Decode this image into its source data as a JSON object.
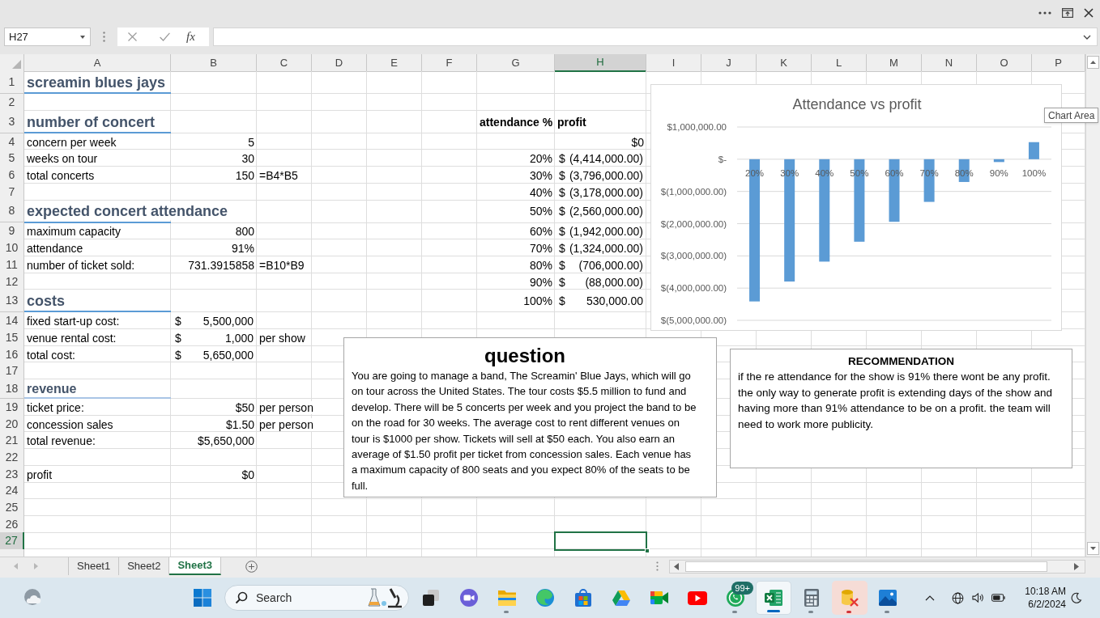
{
  "formula_bar": {
    "name_box": "H27",
    "function_button": "fx"
  },
  "columns": [
    {
      "label": "A",
      "selected": false
    },
    {
      "label": "B",
      "selected": false
    },
    {
      "label": "C",
      "selected": false
    },
    {
      "label": "D",
      "selected": false
    },
    {
      "label": "E",
      "selected": false
    },
    {
      "label": "F",
      "selected": false
    },
    {
      "label": "G",
      "selected": false
    },
    {
      "label": "H",
      "selected": true
    },
    {
      "label": "I",
      "selected": false
    },
    {
      "label": "J",
      "selected": false
    },
    {
      "label": "K",
      "selected": false
    },
    {
      "label": "L",
      "selected": false
    },
    {
      "label": "M",
      "selected": false
    },
    {
      "label": "N",
      "selected": false
    },
    {
      "label": "O",
      "selected": false
    },
    {
      "label": "P",
      "selected": false
    }
  ],
  "rows": [
    {
      "number": "1",
      "selected": false,
      "kind": "heading",
      "label": "screamin blues jays"
    },
    {
      "number": "2",
      "selected": false,
      "kind": "entry"
    },
    {
      "number": "3",
      "selected": false,
      "kind": "heading",
      "label": "number of concert"
    },
    {
      "number": "4",
      "selected": false,
      "kind": "entry",
      "label": "concern per week",
      "value": "5"
    },
    {
      "number": "5",
      "selected": false,
      "kind": "entry",
      "label": "weeks on tour",
      "value": "30"
    },
    {
      "number": "6",
      "selected": false,
      "kind": "entry",
      "label": "total concerts",
      "value": "150",
      "note": "=B4*B5"
    },
    {
      "number": "7",
      "selected": false,
      "kind": "entry"
    },
    {
      "number": "8",
      "selected": false,
      "kind": "heading",
      "label": "expected concert attendance"
    },
    {
      "number": "9",
      "selected": false,
      "kind": "entry",
      "label": "maximum capacity",
      "value": "800"
    },
    {
      "number": "10",
      "selected": false,
      "kind": "entry",
      "label": "attendance",
      "value": "91%"
    },
    {
      "number": "11",
      "selected": false,
      "kind": "entry",
      "label": "number of ticket sold:",
      "value": "731.3915858",
      "note": "=B10*B9"
    },
    {
      "number": "12",
      "selected": false,
      "kind": "entry"
    },
    {
      "number": "13",
      "selected": false,
      "kind": "heading",
      "label": "costs"
    },
    {
      "number": "14",
      "selected": false,
      "kind": "entry",
      "label": "fixed start-up cost:",
      "value": {
        "symbol": "$",
        "amount": "5,500,000"
      }
    },
    {
      "number": "15",
      "selected": false,
      "kind": "entry",
      "label": "venue rental cost:",
      "value": {
        "symbol": "$",
        "amount": "1,000"
      },
      "note": "per show"
    },
    {
      "number": "16",
      "selected": false,
      "kind": "entry",
      "label": "total cost:",
      "value": {
        "symbol": "$",
        "amount": "5,650,000"
      }
    },
    {
      "number": "17",
      "selected": false,
      "kind": "entry"
    },
    {
      "number": "18",
      "selected": false,
      "kind": "subheading",
      "label": "revenue"
    },
    {
      "number": "19",
      "selected": false,
      "kind": "entry",
      "label": "ticket price:",
      "value": "$50",
      "note": "per person"
    },
    {
      "number": "20",
      "selected": false,
      "kind": "entry",
      "label": "concession sales",
      "value": "$1.50",
      "note": "per person"
    },
    {
      "number": "21",
      "selected": false,
      "kind": "entry",
      "label": "total revenue:",
      "value": "$5,650,000"
    },
    {
      "number": "22",
      "selected": false,
      "kind": "entry"
    },
    {
      "number": "23",
      "selected": false,
      "kind": "entry",
      "label": "profit",
      "value": "$0"
    },
    {
      "number": "24",
      "selected": false,
      "kind": "entry"
    },
    {
      "number": "25",
      "selected": false,
      "kind": "entry"
    },
    {
      "number": "26",
      "selected": false,
      "kind": "entry"
    },
    {
      "number": "27",
      "selected": true,
      "kind": "entry"
    }
  ],
  "profit_table": {
    "header": {
      "attendance": "attendance %",
      "profit": "profit"
    },
    "rows": [
      {
        "profit": "$0"
      },
      {
        "attendance": "20%",
        "profit": {
          "symbol": "$",
          "amount": "(4,414,000.00)"
        }
      },
      {
        "attendance": "30%",
        "profit": {
          "symbol": "$",
          "amount": "(3,796,000.00)"
        }
      },
      {
        "attendance": "40%",
        "profit": {
          "symbol": "$",
          "amount": "(3,178,000.00)"
        }
      },
      {
        "attendance": "50%",
        "profit": {
          "symbol": "$",
          "amount": "(2,560,000.00)"
        }
      },
      {
        "attendance": "60%",
        "profit": {
          "symbol": "$",
          "amount": "(1,942,000.00)"
        }
      },
      {
        "attendance": "70%",
        "profit": {
          "symbol": "$",
          "amount": "(1,324,000.00)"
        }
      },
      {
        "attendance": "80%",
        "profit": {
          "symbol": "$",
          "amount": "(706,000.00)"
        }
      },
      {
        "attendance": "90%",
        "profit": {
          "symbol": "$",
          "amount": "(88,000.00)"
        }
      },
      {
        "attendance": "100%",
        "profit": {
          "symbol": "$",
          "amount": "530,000.00"
        }
      }
    ]
  },
  "chart": {
    "tooltip": "Chart Area",
    "chart_data": {
      "type": "bar",
      "title": "Attendance vs profit",
      "grid": true,
      "categories": [
        "20%",
        "30%",
        "40%",
        "50%",
        "60%",
        "70%",
        "80%",
        "90%",
        "100%"
      ],
      "series": [
        {
          "color": "#5b9bd5",
          "values": [
            -4414000,
            -3796000,
            -3178000,
            -2560000,
            -1942000,
            -1324000,
            -706000,
            -88000,
            530000
          ]
        }
      ],
      "ylim": [
        -5000000,
        1000000
      ],
      "yticks": [
        {
          "value": 1000000,
          "label": "$1,000,000.00"
        },
        {
          "value": 0,
          "label": "$-"
        },
        {
          "value": -1000000,
          "label": "$(1,000,000.00)"
        },
        {
          "value": -2000000,
          "label": "$(2,000,000.00)"
        },
        {
          "value": -3000000,
          "label": "$(3,000,000.00)"
        },
        {
          "value": -4000000,
          "label": "$(4,000,000.00)"
        },
        {
          "value": -5000000,
          "label": "$(5,000,000.00)"
        }
      ]
    }
  },
  "question_box": {
    "title": "question",
    "body": "You are going to manage a band, The Screamin' Blue Jays, which will go on tour across the United States. The tour costs $5.5 million to fund and develop. There will be 5 concerts per week and you project the band to be on the road for 30 weeks. The average cost to rent different venues on tour is $1000 per show. Tickets will sell at $50 each. You also earn an average of $1.50 profit per ticket from concession sales. Each venue has a maximum capacity of 800 seats and you expect 80% of the seats to be full."
  },
  "recommendation_box": {
    "title": "RECOMMENDATION",
    "paragraphs": [
      "if the re attendance for the show is 91% there wont be any profit.",
      "the only way to generate profit is extending days of the show and having more than 91% attendance to be on a profit. the team will need to work more publicity."
    ]
  },
  "sheet_tabs": [
    {
      "label": "Sheet1",
      "selected": false
    },
    {
      "label": "Sheet2",
      "selected": false
    },
    {
      "label": "Sheet3",
      "selected": true
    }
  ],
  "taskbar": {
    "search": {
      "placeholder": "Search"
    },
    "apps": [
      {
        "kind": "overlapping-squares",
        "running": false,
        "focused": false,
        "alert": false
      },
      {
        "kind": "camera-bubble",
        "running": false,
        "focused": false,
        "alert": false
      },
      {
        "kind": "folder",
        "running": true,
        "focused": false,
        "alert": false
      },
      {
        "kind": "swirl",
        "running": false,
        "focused": false,
        "alert": false
      },
      {
        "kind": "bag",
        "running": false,
        "focused": false,
        "alert": false
      },
      {
        "kind": "triangle",
        "running": false,
        "focused": false,
        "alert": false
      },
      {
        "kind": "video-camera",
        "running": false,
        "focused": false,
        "alert": false
      },
      {
        "kind": "play",
        "running": false,
        "focused": false,
        "alert": false
      },
      {
        "kind": "phone-bubble",
        "running": true,
        "focused": false,
        "alert": false,
        "badge": "99+"
      },
      {
        "kind": "spreadsheet",
        "running": true,
        "focused": true,
        "alert": false
      },
      {
        "kind": "calculator",
        "running": true,
        "focused": false,
        "alert": false
      },
      {
        "kind": "cylinder-tools",
        "running": true,
        "focused": false,
        "alert": true
      },
      {
        "kind": "mountain-picture",
        "running": true,
        "focused": false,
        "alert": false
      }
    ],
    "clock": {
      "time": "10:18 AM",
      "date": "6/2/2024"
    }
  }
}
